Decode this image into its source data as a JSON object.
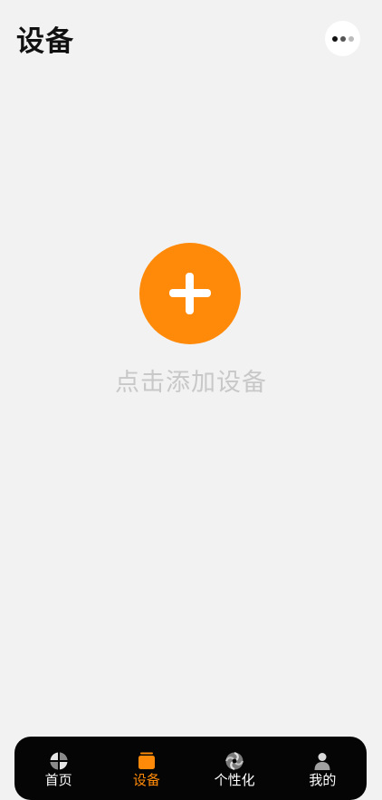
{
  "header": {
    "title": "设备",
    "more_icon": "more-dots-icon"
  },
  "main": {
    "add_icon": "plus-icon",
    "hint": "点击添加设备"
  },
  "tabbar": {
    "items": [
      {
        "label": "首页",
        "icon": "home-sphere-icon",
        "active": false
      },
      {
        "label": "设备",
        "icon": "device-box-icon",
        "active": true
      },
      {
        "label": "个性化",
        "icon": "personalize-swirl-icon",
        "active": false
      },
      {
        "label": "我的",
        "icon": "user-icon",
        "active": false
      }
    ]
  },
  "colors": {
    "accent": "#ff8a0a",
    "background": "#f2f2f2",
    "tabbar": "#050505",
    "hint_text": "#c8c8c8"
  }
}
